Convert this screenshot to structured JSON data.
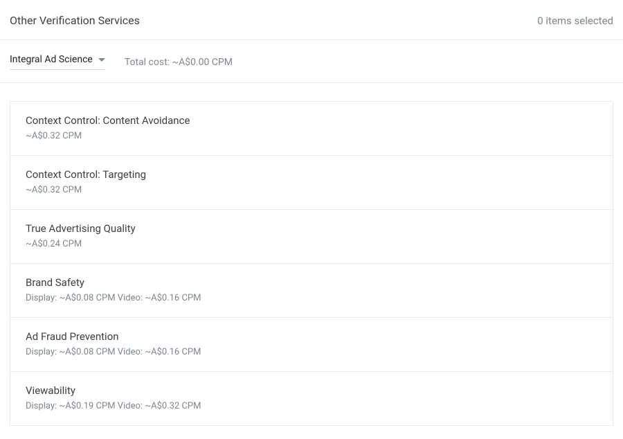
{
  "header": {
    "title": "Other Verification Services",
    "status": "0 items selected"
  },
  "controls": {
    "provider": "Integral Ad Science",
    "total_cost_label": "Total cost: ~A$0.00 CPM"
  },
  "services": [
    {
      "title": "Context Control: Content Avoidance",
      "sub": "~A$0.32 CPM"
    },
    {
      "title": "Context Control: Targeting",
      "sub": "~A$0.32 CPM"
    },
    {
      "title": "True Advertising Quality",
      "sub": "~A$0.24 CPM"
    },
    {
      "title": "Brand Safety",
      "sub": "Display: ~A$0.08 CPM Video: ~A$0.16 CPM"
    },
    {
      "title": "Ad Fraud Prevention",
      "sub": "Display: ~A$0.08 CPM Video: ~A$0.16 CPM"
    },
    {
      "title": "Viewability",
      "sub": "Display: ~A$0.19 CPM Video: ~A$0.32 CPM"
    }
  ]
}
